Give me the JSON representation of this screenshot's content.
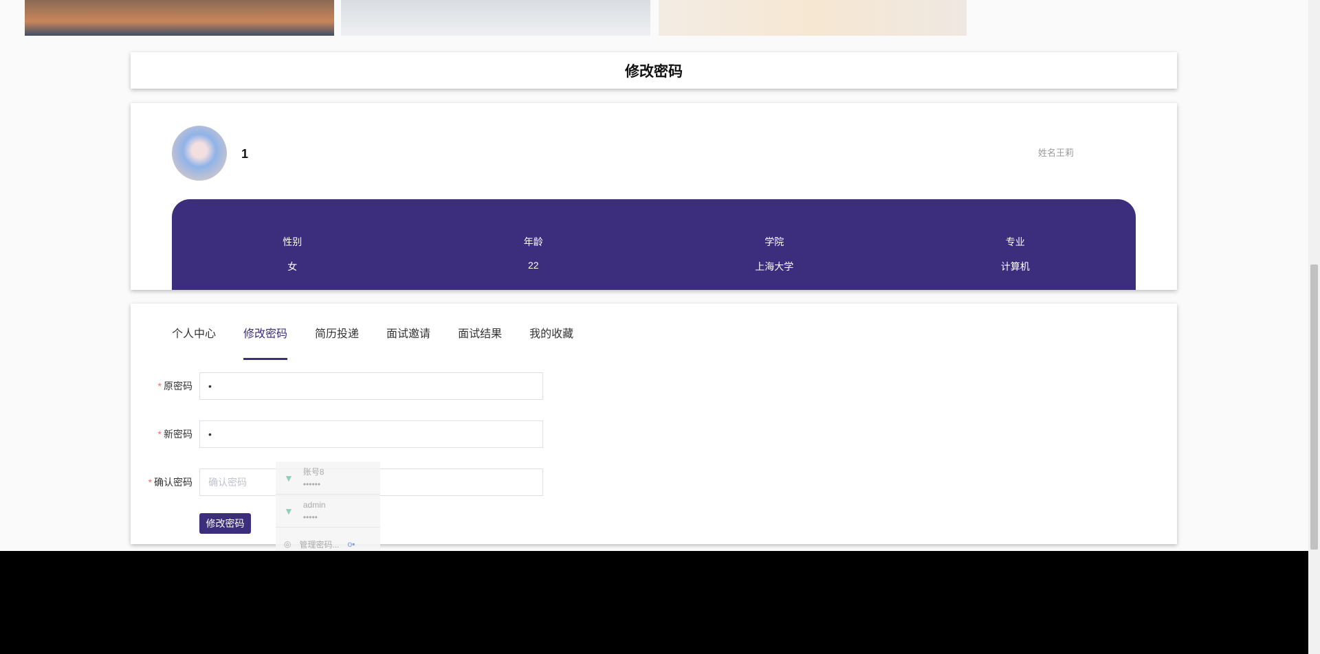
{
  "page": {
    "title": "修改密码"
  },
  "profile": {
    "username": "1",
    "real_name": "姓名王莉",
    "fields": [
      {
        "label": "性别",
        "value": "女"
      },
      {
        "label": "年龄",
        "value": "22"
      },
      {
        "label": "学院",
        "value": "上海大学"
      },
      {
        "label": "专业",
        "value": "计算机"
      }
    ]
  },
  "tabs": [
    {
      "label": "个人中心"
    },
    {
      "label": "修改密码",
      "active": true
    },
    {
      "label": "简历投递"
    },
    {
      "label": "面试邀请"
    },
    {
      "label": "面试结果"
    },
    {
      "label": "我的收藏"
    }
  ],
  "form": {
    "old_password": {
      "label": "原密码",
      "value": "•"
    },
    "new_password": {
      "label": "新密码",
      "value": "•"
    },
    "confirm_password": {
      "label": "确认密码",
      "placeholder": "确认密码"
    },
    "required_mark": "*",
    "submit_label": "修改密码"
  },
  "autofill": {
    "items": [
      {
        "user": "账号8",
        "pass": "••••••"
      },
      {
        "user": "admin",
        "pass": "•••••"
      }
    ],
    "manage_label": "管理密码..."
  },
  "colors": {
    "accent": "#3d2d7d",
    "required": "#f56c6c"
  }
}
